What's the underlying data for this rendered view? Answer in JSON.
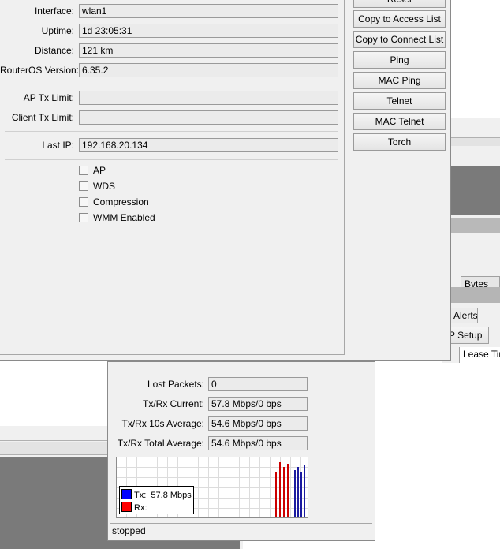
{
  "main_window": {
    "fields": [
      {
        "label": "Interface:",
        "value": "wlan1"
      },
      {
        "label": "Uptime:",
        "value": "1d 23:05:31"
      },
      {
        "label": "Distance:",
        "value": "121 km"
      },
      {
        "label": "RouterOS Version:",
        "value": "6.35.2"
      },
      {
        "label": "AP Tx Limit:",
        "value": ""
      },
      {
        "label": "Client Tx Limit:",
        "value": ""
      },
      {
        "label": "Last IP:",
        "value": "192.168.20.134"
      }
    ],
    "checkboxes": [
      {
        "label": "AP",
        "checked": false
      },
      {
        "label": "WDS",
        "checked": false
      },
      {
        "label": "Compression",
        "checked": false
      },
      {
        "label": "WMM Enabled",
        "checked": false
      }
    ],
    "buttons": [
      {
        "label": "Reset"
      },
      {
        "label": "Copy to Access List"
      },
      {
        "label": "Copy to Connect List"
      },
      {
        "label": "Ping"
      },
      {
        "label": "MAC Ping"
      },
      {
        "label": "Telnet"
      },
      {
        "label": "MAC Telnet"
      },
      {
        "label": "Torch"
      }
    ]
  },
  "stats_window": {
    "fields": [
      {
        "label": "Lost Packets:",
        "value": "0"
      },
      {
        "label": "Tx/Rx Current:",
        "value": "57.8 Mbps/0 bps"
      },
      {
        "label": "Tx/Rx 10s Average:",
        "value": "54.6 Mbps/0 bps"
      },
      {
        "label": "Tx/Rx Total Average:",
        "value": "54.6 Mbps/0 bps"
      }
    ],
    "legend": {
      "tx_label": "Tx:",
      "tx_value": "57.8 Mbps",
      "rx_label": "Rx:",
      "tx_color": "#0000ff",
      "rx_color": "#ff0000"
    },
    "status": "stopped"
  },
  "background_window": {
    "column_header": "Bytes",
    "tab_alerts": "Alerts",
    "button_setup": "P Setup",
    "column_lease": "Lease Tim"
  }
}
